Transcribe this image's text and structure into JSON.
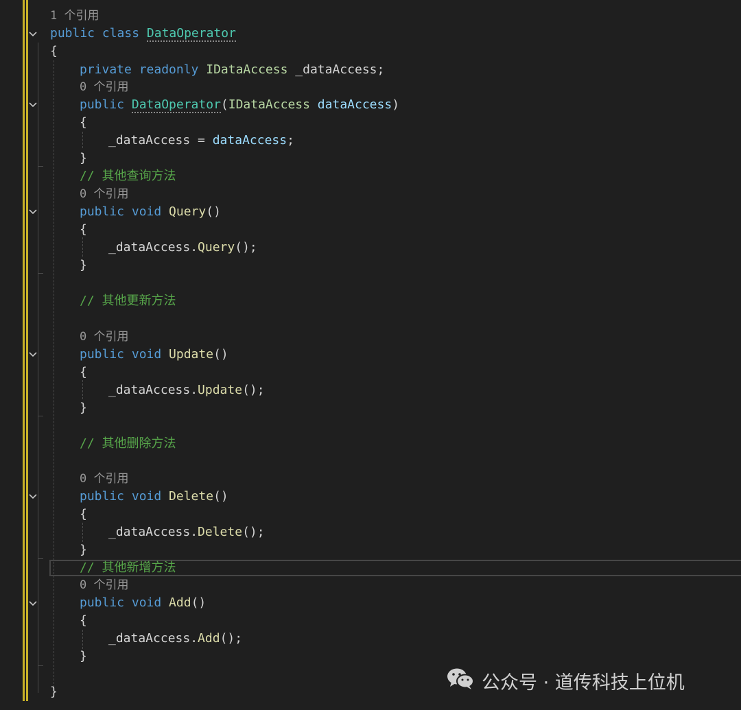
{
  "colors": {
    "background": "#1f1f1f",
    "keyword": "#569cd6",
    "type": "#4ec9b0",
    "method": "#dcdcaa",
    "parameter": "#9cdcfe",
    "comment": "#57a64a",
    "codelens": "#999999",
    "change_bar": "#c9b228"
  },
  "code": {
    "lens_1": "1 个引用",
    "class_kw": "public class ",
    "class_name": "DataOperator",
    "brace_open": "{",
    "field_kw": "private readonly ",
    "field_type": "IDataAccess",
    "field_name": " _dataAccess;",
    "lens_ctor": "0 个引用",
    "ctor_kw": "public ",
    "ctor_name": "DataOperator",
    "ctor_paren_open": "(",
    "ctor_param_type": "IDataAccess",
    "ctor_param_name": " dataAccess",
    "ctor_paren_close": ")",
    "ctor_brace_open": "{",
    "ctor_body_left": "_dataAccess = ",
    "ctor_body_right": "dataAccess",
    "ctor_body_semicolon": ";",
    "ctor_brace_close": "}",
    "comment_query": "// 其他查询方法",
    "lens_query": "0 个引用",
    "query_kw": "public void ",
    "query_name": "Query",
    "query_parens": "()",
    "query_brace_open": "{",
    "query_body_obj": "_dataAccess.",
    "query_body_call": "Query",
    "query_body_end": "();",
    "query_brace_close": "}",
    "comment_update": "// 其他更新方法",
    "lens_update": "0 个引用",
    "update_kw": "public void ",
    "update_name": "Update",
    "update_parens": "()",
    "update_brace_open": "{",
    "update_body_obj": "_dataAccess.",
    "update_body_call": "Update",
    "update_body_end": "();",
    "update_brace_close": "}",
    "comment_delete": "// 其他删除方法",
    "lens_delete": "0 个引用",
    "delete_kw": "public void ",
    "delete_name": "Delete",
    "delete_parens": "()",
    "delete_brace_open": "{",
    "delete_body_obj": "_dataAccess.",
    "delete_body_call": "Delete",
    "delete_body_end": "();",
    "delete_brace_close": "}",
    "comment_add": "// 其他新增方法",
    "lens_add": "0 个引用",
    "add_kw": "public void ",
    "add_name": "Add",
    "add_parens": "()",
    "add_brace_open": "{",
    "add_body_obj": "_dataAccess.",
    "add_body_call": "Add",
    "add_body_end": "();",
    "add_brace_close": "}",
    "brace_close": "}"
  },
  "icons": {
    "fold": "chevron-down-icon",
    "watermark": "wechat-icon"
  },
  "watermark": {
    "text": "公众号 · 道传科技上位机"
  }
}
